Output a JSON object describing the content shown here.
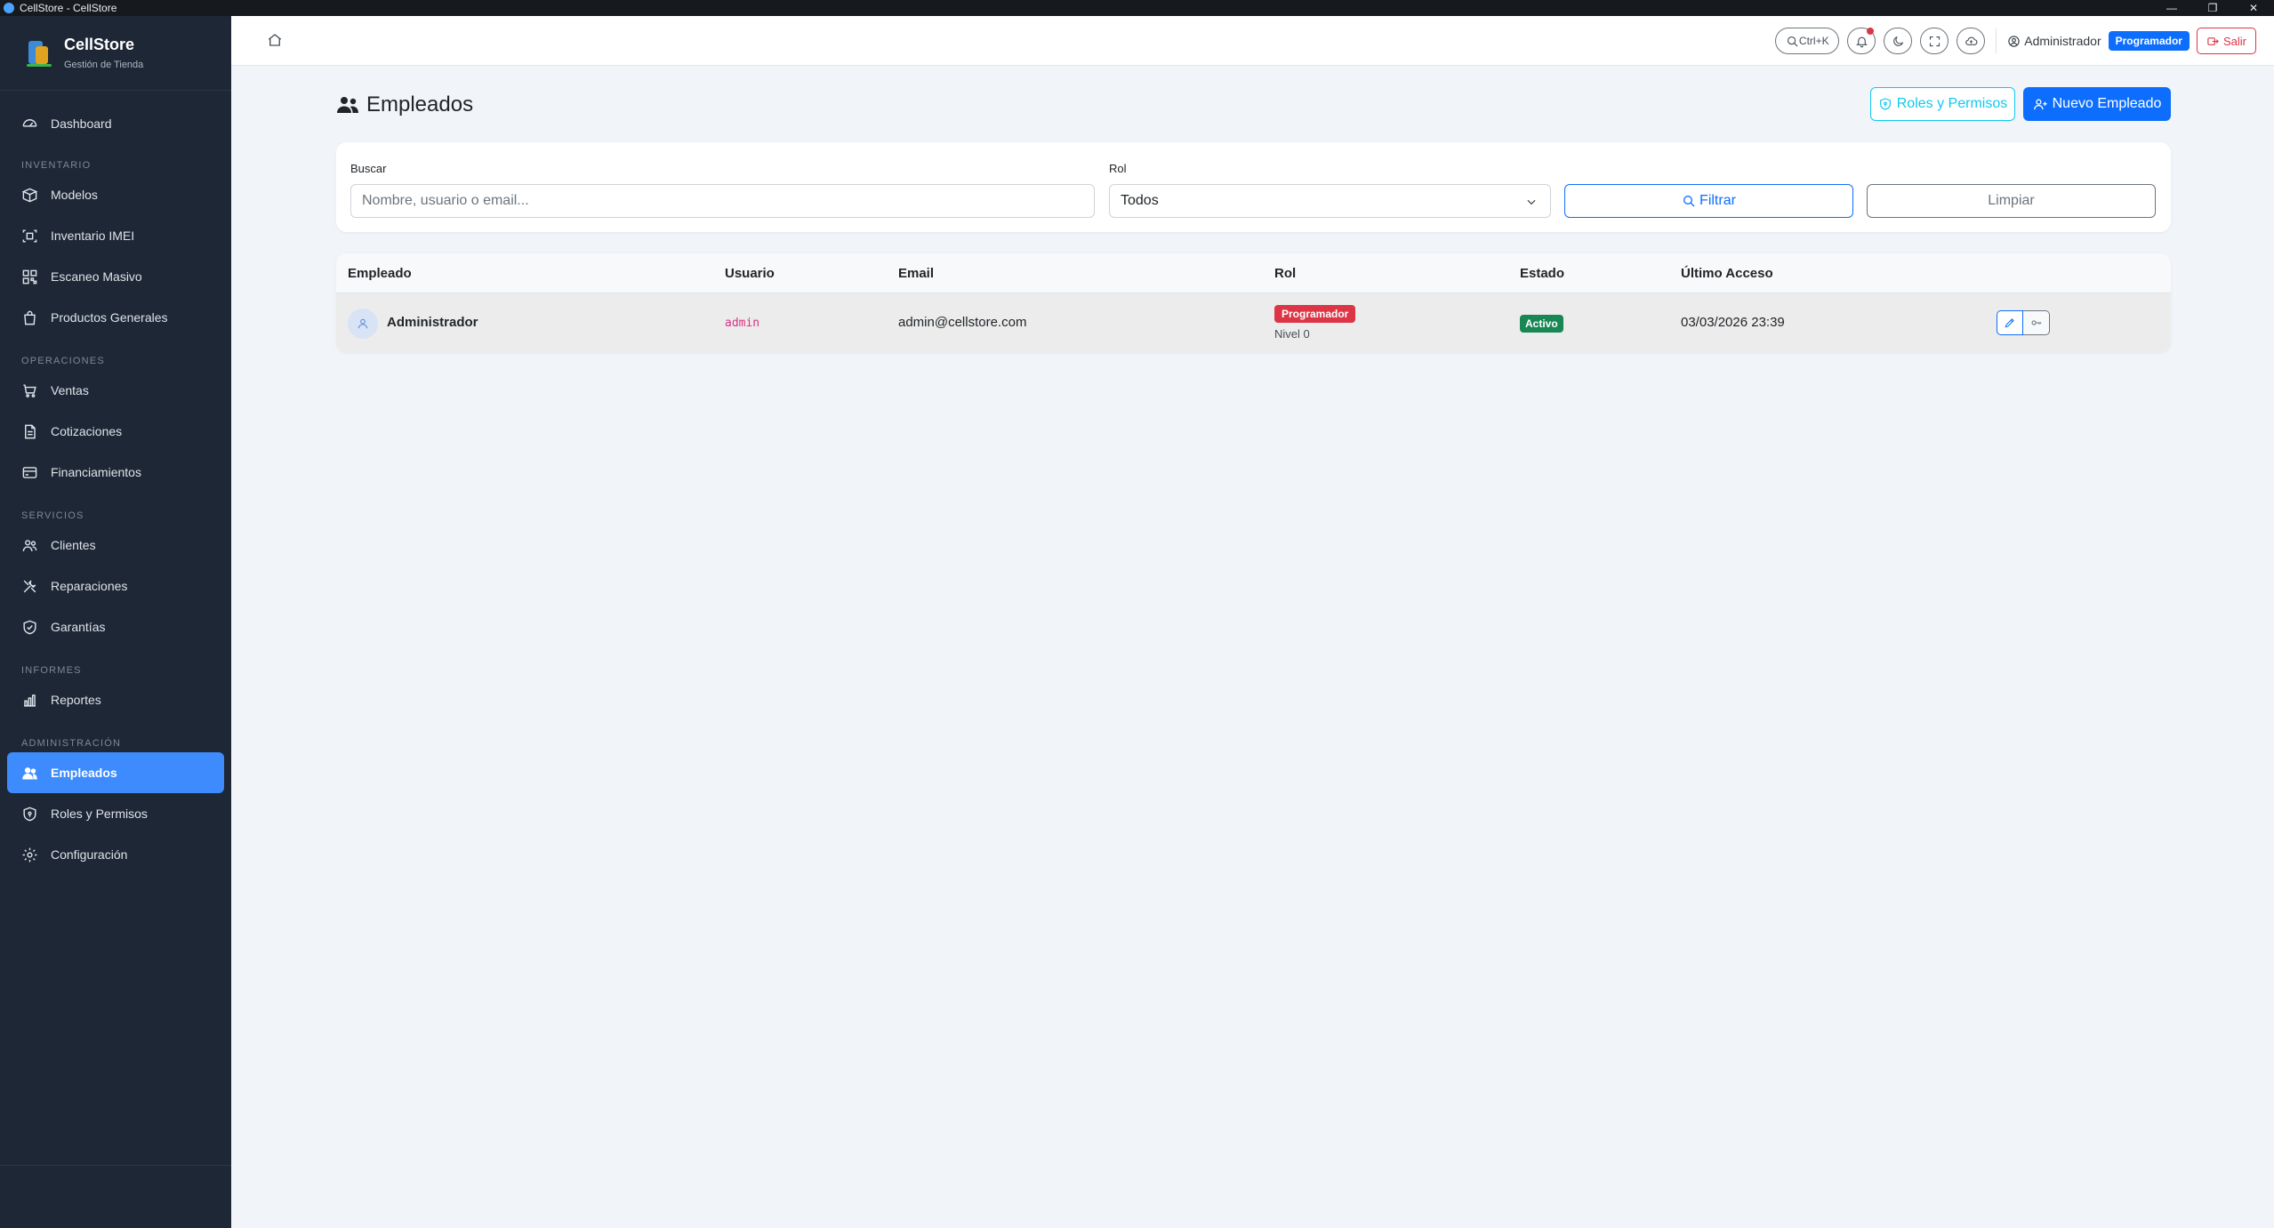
{
  "window": {
    "title": "CellStore - CellStore",
    "minimize": "—",
    "restore": "❐",
    "close": "✕"
  },
  "brand": {
    "name": "CellStore",
    "subtitle": "Gestión de Tienda"
  },
  "sidebar": {
    "dashboard": "Dashboard",
    "sections": {
      "inventario": "INVENTARIO",
      "operaciones": "OPERACIONES",
      "servicios": "SERVICIOS",
      "informes": "INFORMES",
      "administracion": "ADMINISTRACIÓN"
    },
    "items": {
      "modelos": "Modelos",
      "inventario_imei": "Inventario IMEI",
      "escaneo_masivo": "Escaneo Masivo",
      "productos_generales": "Productos Generales",
      "ventas": "Ventas",
      "cotizaciones": "Cotizaciones",
      "financiamientos": "Financiamientos",
      "clientes": "Clientes",
      "reparaciones": "Reparaciones",
      "garantias": "Garantías",
      "reportes": "Reportes",
      "empleados": "Empleados",
      "roles_permisos": "Roles y Permisos",
      "configuracion": "Configuración"
    }
  },
  "topbar": {
    "search_shortcut": "Ctrl+K",
    "user": "Administrador",
    "role_badge": "Programador",
    "logout": "Salir"
  },
  "page": {
    "title": "Empleados",
    "roles_button": "Roles y Permisos",
    "new_button": "Nuevo Empleado"
  },
  "filters": {
    "search_label": "Buscar",
    "search_placeholder": "Nombre, usuario o email...",
    "role_label": "Rol",
    "role_value": "Todos",
    "filter_button": "Filtrar",
    "clear_button": "Limpiar"
  },
  "table": {
    "headers": {
      "empleado": "Empleado",
      "usuario": "Usuario",
      "email": "Email",
      "rol": "Rol",
      "estado": "Estado",
      "ultimo_acceso": "Último Acceso"
    },
    "rows": [
      {
        "name": "Administrador",
        "username": "admin",
        "email": "admin@cellstore.com",
        "role": "Programador",
        "level": "Nivel 0",
        "status": "Activo",
        "last_access": "03/03/2026 23:39"
      }
    ]
  },
  "colors": {
    "sidebar_bg": "#1e2735",
    "active_item": "#3d8bfd",
    "primary": "#0d6efd",
    "info": "#0dcaf0",
    "danger": "#dc3545",
    "success": "#198754"
  }
}
